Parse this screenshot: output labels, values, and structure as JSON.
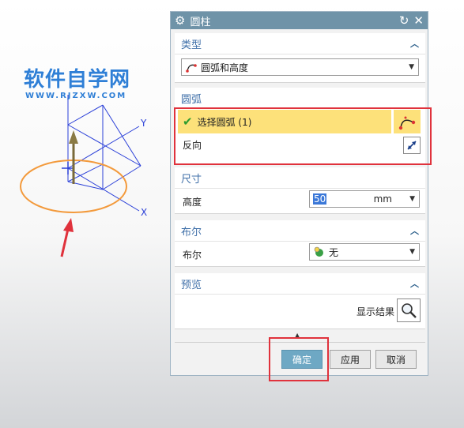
{
  "watermark": {
    "title": "软件自学网",
    "url": "WWW.RJZXW.COM"
  },
  "viewport": {
    "axis_y": "Y",
    "axis_x": "X"
  },
  "dialog": {
    "title": "圆柱",
    "sections": {
      "type": {
        "header": "类型",
        "value": "圆弧和高度"
      },
      "arc": {
        "header": "圆弧",
        "select_label": "选择圆弧 (1)",
        "reverse_label": "反向"
      },
      "dims": {
        "header": "尺寸",
        "height_label": "高度",
        "height_value": "50",
        "unit": "mm"
      },
      "boolean": {
        "header": "布尔",
        "label": "布尔",
        "value": "无"
      },
      "preview": {
        "header": "预览",
        "show_result_label": "显示结果"
      }
    },
    "buttons": {
      "ok": "确定",
      "apply": "应用",
      "cancel": "取消"
    }
  },
  "colors": {
    "titlebar": "#6f93a8",
    "highlight": "#fde17a",
    "section_header": "#3f6fa8",
    "callout": "#e0323c",
    "arc": "#f39a3c"
  }
}
